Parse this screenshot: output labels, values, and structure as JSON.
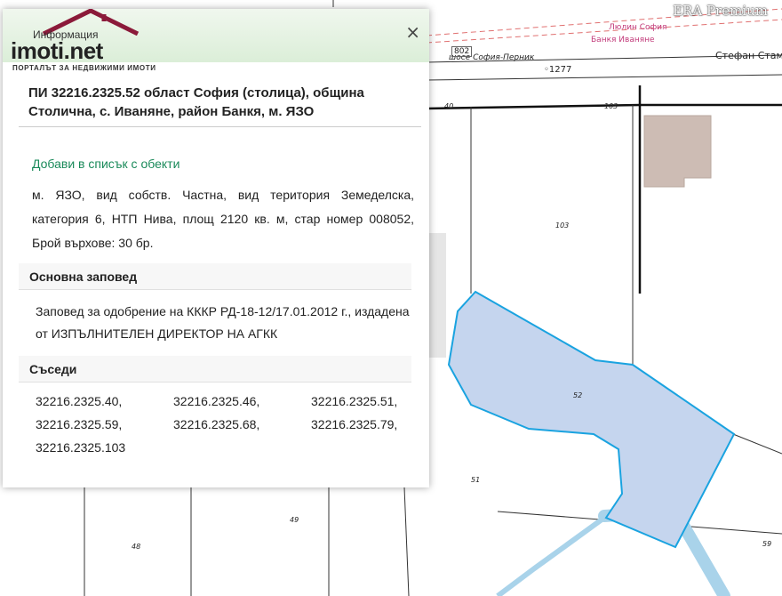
{
  "brand": {
    "watermark": "ERA Premium"
  },
  "map": {
    "street_labels": [
      "Стефан Стамб",
      "Люлин  София",
      "Банкя  Иваняне",
      "шосе София-Перник",
      "802"
    ],
    "elevation_label": "◦1277",
    "parcel_numbers": [
      "40",
      "103",
      "103",
      "52",
      "51",
      "49",
      "48",
      "59"
    ],
    "selected_parcel_fill": "#c5d5ee",
    "selected_parcel_stroke": "#1aa3e0",
    "road_color": "#a9d3ea"
  },
  "panel": {
    "logo_small": "Информация",
    "logo_main": "imoti.net",
    "logo_tagline": "ПОРТАЛЪТ ЗА НЕДВИЖИМИ ИМОТИ",
    "close_glyph": "×",
    "title": "ПИ 32216.2325.52 област София (столица), община Столична, с. Иваняне, район Банкя, м. ЯЗО",
    "add_link": "Добави в списък с обекти",
    "description": "м. ЯЗО, вид собств. Частна, вид територия Земеделска, категория 6, НТП Нива, площ 2120 кв. м, стар номер 008052, Брой върхове: 30 бр.",
    "section_order": "Основна заповед",
    "order_text": "Заповед за одобрение на КККР РД-18-12/17.01.2012 г., издадена от ИЗПЪЛНИТЕЛЕН ДИРЕКТОР НА АГКК",
    "section_neighbors": "Съседи",
    "neighbors": [
      "32216.2325.40,",
      "32216.2325.46,",
      "32216.2325.51,",
      "32216.2325.59,",
      "32216.2325.68,",
      "32216.2325.79,",
      "32216.2325.103"
    ]
  }
}
